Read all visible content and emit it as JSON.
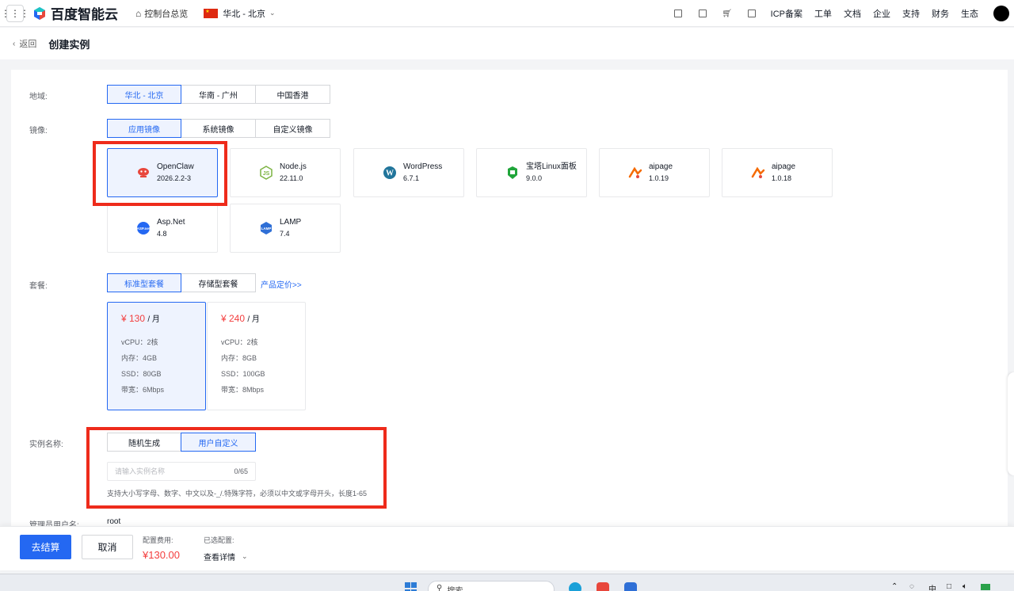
{
  "topbar": {
    "logo_text": "百度智能云",
    "console_link": "控制台总览",
    "region": "华北 - 北京",
    "links": [
      "ICP备案",
      "工单",
      "文档",
      "企业",
      "支持",
      "财务",
      "生态"
    ],
    "icons": [
      "qrcode-icon",
      "message-icon",
      "cart-icon",
      "ipv6-icon"
    ]
  },
  "subheader": {
    "back_label": "返回",
    "title": "创建实例"
  },
  "form": {
    "region": {
      "label": "地域:",
      "options": [
        "华北 - 北京",
        "华南 - 广州",
        "中国香港"
      ],
      "selected": "华北 - 北京"
    },
    "image": {
      "label": "镜像:",
      "tabs": [
        "应用镜像",
        "系统镜像",
        "自定义镜像"
      ],
      "selected_tab": "应用镜像",
      "cards": [
        {
          "name": "OpenClaw",
          "version": "2026.2.2-3",
          "icon": "openclaw-icon",
          "color": "#e8473c",
          "selected": true
        },
        {
          "name": "Node.js",
          "version": "22.11.0",
          "icon": "nodejs-icon",
          "color": "#7cb342",
          "selected": false
        },
        {
          "name": "WordPress",
          "version": "6.7.1",
          "icon": "wordpress-icon",
          "color": "#21759b",
          "selected": false
        },
        {
          "name": "宝塔Linux面板",
          "version": "9.0.0",
          "icon": "baota-icon",
          "color": "#20a53a",
          "selected": false
        },
        {
          "name": "aipage",
          "version": "1.0.19",
          "icon": "aipage-icon",
          "color": "#f56a00",
          "selected": false
        },
        {
          "name": "aipage",
          "version": "1.0.18",
          "icon": "aipage-icon",
          "color": "#f56a00",
          "selected": false
        },
        {
          "name": "Asp.Net",
          "version": "4.8",
          "icon": "aspnet-icon",
          "color": "#2468f2",
          "selected": false
        },
        {
          "name": "LAMP",
          "version": "7.4",
          "icon": "lamp-icon",
          "color": "#2f6fd6",
          "selected": false
        }
      ]
    },
    "plan": {
      "label": "套餐:",
      "tabs": [
        "标准型套餐",
        "存储型套餐"
      ],
      "selected_tab": "标准型套餐",
      "pricing_link": "产品定价>>",
      "cards": [
        {
          "price": "¥ 130",
          "unit": "/ 月",
          "vcpu": "vCPU：2核",
          "memory": "内存：4GB",
          "ssd": "SSD：80GB",
          "bandwidth": "带宽：6Mbps",
          "selected": true
        },
        {
          "price": "¥ 240",
          "unit": "/ 月",
          "vcpu": "vCPU：2核",
          "memory": "内存：8GB",
          "ssd": "SSD：100GB",
          "bandwidth": "带宽：8Mbps",
          "selected": false
        }
      ]
    },
    "instance_name": {
      "label": "实例名称:",
      "options": [
        "随机生成",
        "用户自定义"
      ],
      "selected": "用户自定义",
      "placeholder": "请输入实例名称",
      "value": "",
      "counter": "0/65",
      "hint": "支持大小写字母、数字、中文以及-_/.特殊字符，必须以中文或字母开头，长度1-65"
    },
    "admin_username": {
      "label": "管理员用户名:",
      "value": "root"
    }
  },
  "footer": {
    "checkout_label": "去结算",
    "cancel_label": "取消",
    "fee_label": "配置费用:",
    "fee_value": "¥130.00",
    "selected_config_label": "已选配置:",
    "detail_label": "查看详情"
  },
  "taskbar": {
    "search_label": "搜索",
    "tray_lang": "中"
  },
  "colors": {
    "accent": "#2468f2",
    "price_red": "#f33e3e",
    "highlight_box": "#ee2b1b"
  }
}
